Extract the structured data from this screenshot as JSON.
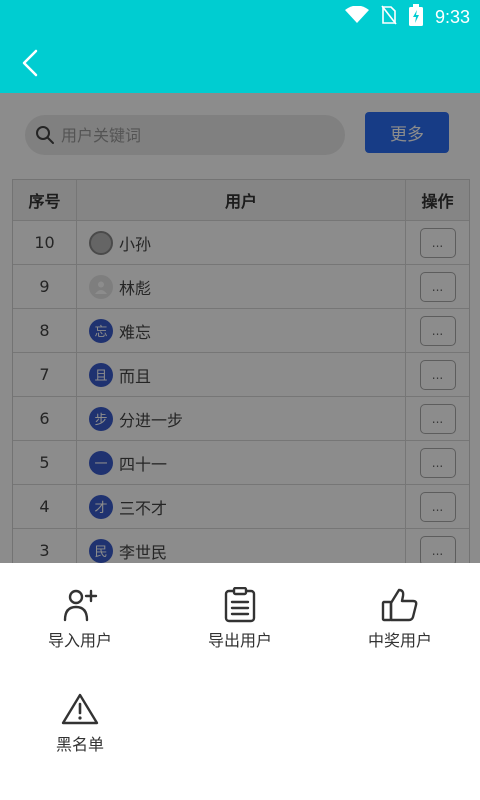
{
  "status_bar": {
    "time": "9:33"
  },
  "search": {
    "placeholder": "用户关键词"
  },
  "more_label": "更多",
  "table": {
    "headers": {
      "index": "序号",
      "user": "用户",
      "action": "操作"
    },
    "rows": [
      {
        "index": "10",
        "avatar": "",
        "name": "小孙"
      },
      {
        "index": "9",
        "avatar": "",
        "name": "林彪"
      },
      {
        "index": "8",
        "avatar": "忘",
        "name": "难忘"
      },
      {
        "index": "7",
        "avatar": "且",
        "name": "而且"
      },
      {
        "index": "6",
        "avatar": "步",
        "name": "分进一步"
      },
      {
        "index": "5",
        "avatar": "一",
        "name": "四十一"
      },
      {
        "index": "4",
        "avatar": "才",
        "name": "三不才"
      },
      {
        "index": "3",
        "avatar": "民",
        "name": "李世民"
      }
    ],
    "action_label": "..."
  },
  "sheet": {
    "import_label": "导入用户",
    "export_label": "导出用户",
    "winner_label": "中奖用户",
    "blacklist_label": "黑名单"
  },
  "colors": {
    "header": "#00cdd1",
    "accent": "#2a6df4",
    "avatar": "#3a5ccc"
  }
}
